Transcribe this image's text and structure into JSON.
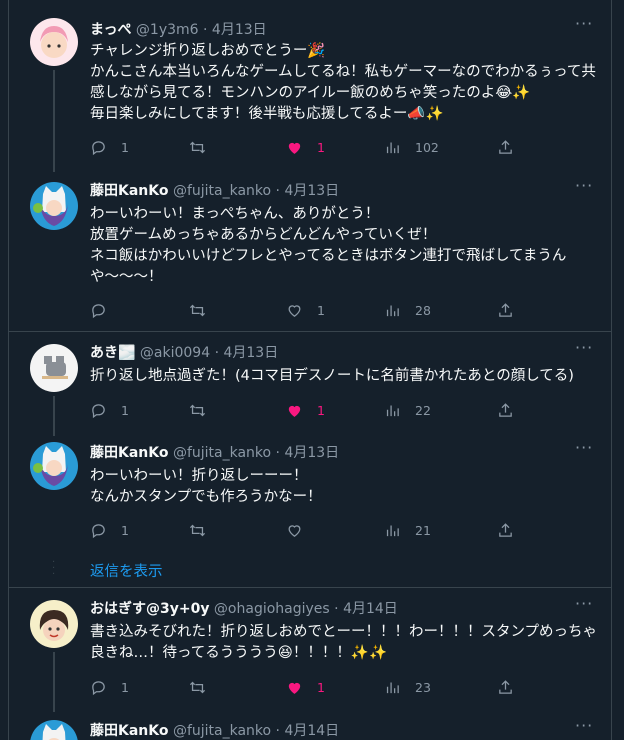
{
  "tweets": [
    {
      "name": "まっぺ",
      "handle": "@1y3m6",
      "date": "4月13日",
      "text": "チャレンジ折り返しおめでとうー🎉\nかんこさん本当いろんなゲームしてるね！私もゲーマーなのでわかるぅって共感しながら見てる！モンハンのアイルー飯のめちゃ笑ったのよ😂✨\n毎日楽しみにしてます！後半戦も応援してるよー📣✨",
      "replies": "1",
      "retweets": "",
      "likes": "1",
      "liked": true,
      "views": "102"
    },
    {
      "name": "藤田KanKo",
      "handle": "@fujita_kanko",
      "date": "4月13日",
      "text": "わーいわーい！まっぺちゃん、ありがとう！\n放置ゲームめっちゃあるからどんどんやっていくぜ！\nネコ飯はかわいいけどフレとやってるときはボタン連打で飛ばしてまうんや〜〜〜！",
      "replies": "",
      "retweets": "",
      "likes": "1",
      "liked": false,
      "views": "28"
    },
    {
      "name": "あき🌫️",
      "handle": "@aki0094",
      "date": "4月13日",
      "text": "折り返し地点過ぎた！(4コマ目デスノートに名前書かれたあとの顔してる)",
      "replies": "1",
      "retweets": "",
      "likes": "1",
      "liked": true,
      "views": "22"
    },
    {
      "name": "藤田KanKo",
      "handle": "@fujita_kanko",
      "date": "4月13日",
      "text": "わーいわーい！折り返しーーー！\nなんかスタンプでも作ろうかなー！",
      "replies": "1",
      "retweets": "",
      "likes": "",
      "liked": false,
      "views": "21"
    },
    {
      "name": "おはぎす@3y+0y",
      "handle": "@ohagiohagiyes",
      "date": "4月14日",
      "text": "書き込みそびれた！折り返しおめでとーー！！！わー！！！スタンプめっちゃ良きね…！待ってるうううう😆！！！！✨✨",
      "replies": "1",
      "retweets": "",
      "likes": "1",
      "liked": true,
      "views": "23"
    },
    {
      "name": "藤田KanKo",
      "handle": "@fujita_kanko",
      "date": "4月14日"
    }
  ],
  "show_replies": "返信を表示",
  "separator": "·",
  "more": "···",
  "colors": {
    "background": "#15202b",
    "border": "#38444d",
    "muted": "#8b98a5",
    "like": "#f91880",
    "link": "#1d9bf0"
  }
}
